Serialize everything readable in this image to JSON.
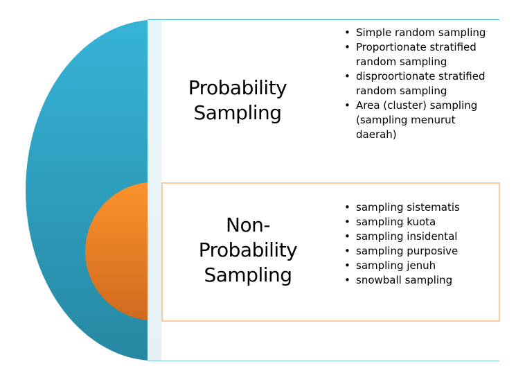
{
  "diagram": {
    "colors": {
      "outer_shape_top": "#36b3d8",
      "outer_shape_bottom": "#2688a2",
      "inner_circle_top": "#fd922c",
      "inner_circle_bottom": "#cf6a1f",
      "panel_line": "#3aa9c9",
      "inner_box_border": "#f9c9a0",
      "strip": "#e8f5fb"
    },
    "outer": {
      "title": "Probability Sampling",
      "title_lines": [
        "Probability",
        "Sampling"
      ],
      "items": [
        "Simple random sampling",
        "Proportionate stratified random sampling",
        "disproortionate stratified random sampling",
        "Area (cluster) sampling (sampling menurut daerah)"
      ]
    },
    "inner": {
      "title": "Non-Probability Sampling",
      "title_lines": [
        "Non-",
        "Probability",
        "Sampling"
      ],
      "items": [
        "sampling sistematis",
        "sampling kuota",
        "sampling insidental",
        "sampling purposive",
        "sampling jenuh",
        "snowball sampling"
      ]
    }
  }
}
